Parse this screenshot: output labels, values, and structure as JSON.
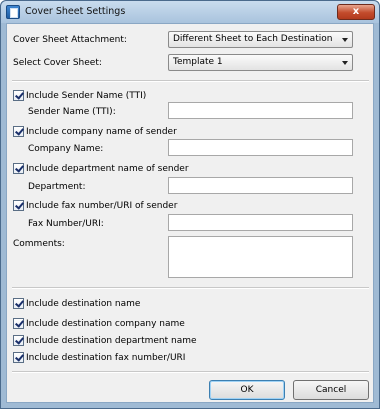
{
  "window": {
    "title": "Cover Sheet Settings",
    "close_label": "x"
  },
  "attachment": {
    "label": "Cover Sheet Attachment:",
    "selected": "Different Sheet to Each Destination"
  },
  "cover_sheet": {
    "label": "Select Cover Sheet:",
    "selected": "Template 1"
  },
  "sender_name": {
    "checkbox_label": "Include Sender Name (TTI)",
    "field_label": "Sender Name (TTI):",
    "value": "",
    "checked": true
  },
  "company": {
    "checkbox_label": "Include company name of sender",
    "field_label": "Company Name:",
    "value": "",
    "checked": true
  },
  "department": {
    "checkbox_label": "Include department name of sender",
    "field_label": "Department:",
    "value": "",
    "checked": true
  },
  "fax": {
    "checkbox_label": "Include fax number/URI of sender",
    "field_label": "Fax Number/URI:",
    "value": "",
    "checked": true
  },
  "comments": {
    "label": "Comments:",
    "value": ""
  },
  "destination": [
    {
      "label": "Include destination name",
      "checked": true
    },
    {
      "label": "Include destination company name",
      "checked": true
    },
    {
      "label": "Include destination department name",
      "checked": true
    },
    {
      "label": "Include destination fax number/URI",
      "checked": true
    }
  ],
  "buttons": {
    "ok": "OK",
    "cancel": "Cancel"
  }
}
